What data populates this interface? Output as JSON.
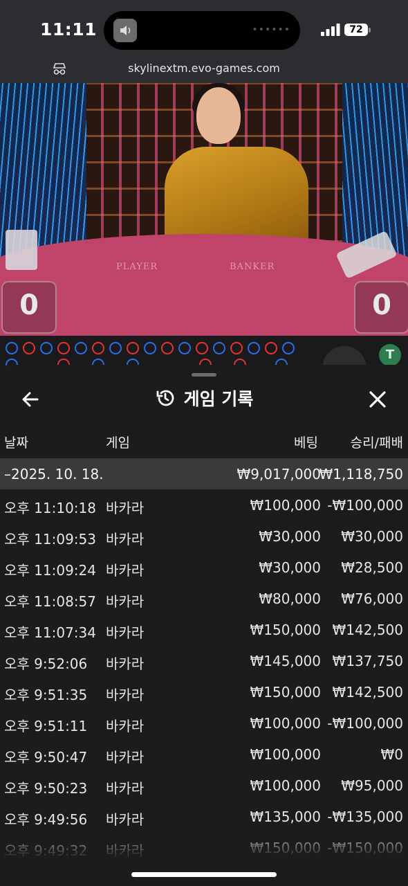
{
  "status_bar": {
    "time": "11:11",
    "battery": "72"
  },
  "browser": {
    "url": "skylinextm.evo-games.com"
  },
  "video": {
    "player_label": "PLAYER",
    "banker_label": "BANKER",
    "player_score": "0",
    "banker_score": "0",
    "tie_badge": "T"
  },
  "colors": {
    "player_blue": "#2b6de6",
    "banker_red": "#e53333",
    "summary_bg": "#3a3a3c",
    "panel_bg": "#1c1c1e"
  },
  "history": {
    "title": "게임 기록",
    "columns": {
      "date": "날짜",
      "game": "게임",
      "bet": "베팅",
      "win_loss": "승리/패배"
    },
    "summary": {
      "date": "–2025. 10. 18.",
      "bet": "₩9,017,000",
      "win_loss": "₩1,118,750"
    },
    "rows": [
      {
        "time": "오후 11:10:18",
        "game": "바카라",
        "bet": "₩100,000",
        "win_loss": "-₩100,000"
      },
      {
        "time": "오후 11:09:53",
        "game": "바카라",
        "bet": "₩30,000",
        "win_loss": "₩30,000"
      },
      {
        "time": "오후 11:09:24",
        "game": "바카라",
        "bet": "₩30,000",
        "win_loss": "₩28,500"
      },
      {
        "time": "오후 11:08:57",
        "game": "바카라",
        "bet": "₩80,000",
        "win_loss": "₩76,000"
      },
      {
        "time": "오후 11:07:34",
        "game": "바카라",
        "bet": "₩150,000",
        "win_loss": "₩142,500"
      },
      {
        "time": "오후 9:52:06",
        "game": "바카라",
        "bet": "₩145,000",
        "win_loss": "₩137,750"
      },
      {
        "time": "오후 9:51:35",
        "game": "바카라",
        "bet": "₩150,000",
        "win_loss": "₩142,500"
      },
      {
        "time": "오후 9:51:11",
        "game": "바카라",
        "bet": "₩100,000",
        "win_loss": "-₩100,000"
      },
      {
        "time": "오후 9:50:47",
        "game": "바카라",
        "bet": "₩100,000",
        "win_loss": "₩0"
      },
      {
        "time": "오후 9:50:23",
        "game": "바카라",
        "bet": "₩100,000",
        "win_loss": "₩95,000"
      },
      {
        "time": "오후 9:49:56",
        "game": "바카라",
        "bet": "₩135,000",
        "win_loss": "-₩135,000"
      },
      {
        "time": "오후 9:49:32",
        "game": "바카라",
        "bet": "₩150,000",
        "win_loss": "-₩150,000"
      }
    ]
  }
}
